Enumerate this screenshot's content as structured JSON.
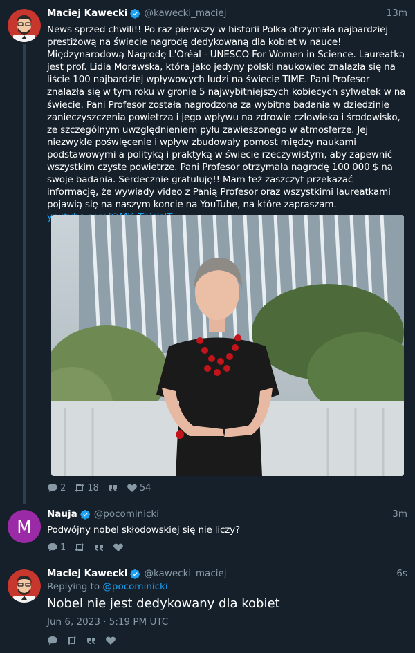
{
  "tweets": [
    {
      "name": "Maciej Kawecki",
      "handle": "@kawecki_maciej",
      "time": "13m",
      "text": "News sprzed chwili!! Po raz pierwszy w historii Polka otrzymała najbardziej prestiżową na świecie nagrodę dedykowaną dla kobiet w nauce! Międzynarodową Nagrodę L'Oréal - UNESCO For Women in Science. Laureatką jest prof. Lidia Morawska, która jako jedyny polski naukowiec znalazła się na liście 100 najbardziej wpływowych ludzi na świecie TIME. Pani Profesor znalazła się w tym roku w gronie 5 najwybitniejszych kobiecych sylwetek w na świecie. Pani Profesor została nagrodzona za wybitne badania w dziedzinie zanieczyszczenia powietrza i jego wpływu na zdrowie człowieka i środowisko, ze szczególnym uwzględnieniem pyłu zawieszonego w atmosferze. Jej niezwykłe poświęcenie i wpływ zbudowały pomost między naukami podstawowymi a polityką i praktyką w świecie rzeczywistym, aby zapewnić wszystkim czyste powietrze. Pani Profesor otrzymała nagrodę 100 000 $ na swoje badania. Serdecznie gratuluję!! Mam też zaszczyt przekazać informację, że wywiady video z Panią Profesor oraz wszystkimi laureatkami pojawią się na naszym koncie na YouTube, na które zapraszam. ",
      "link": "youtube.com/@MK_ThisIsIT",
      "replies": "2",
      "retweets": "18",
      "likes": "54"
    },
    {
      "name": "Nauja",
      "handle": "@pocominicki",
      "time": "3m",
      "avatar_letter": "M",
      "text": "Podwójny nobel skłodowskiej się nie liczy?",
      "replies": "1"
    },
    {
      "name": "Maciej Kawecki",
      "handle": "@kawecki_maciej",
      "time": "6s",
      "replying_label": "Replying to",
      "replying_to": "@pocominicki",
      "text": "Nobel nie jest dedykowany dla kobiet",
      "datetime": "Jun 6, 2023 · 5:19 PM UTC"
    }
  ],
  "colors": {
    "background": "#15202b",
    "accent": "#1da1f2",
    "muted": "#8899a6",
    "avatar_purple": "#9b2aa6"
  }
}
